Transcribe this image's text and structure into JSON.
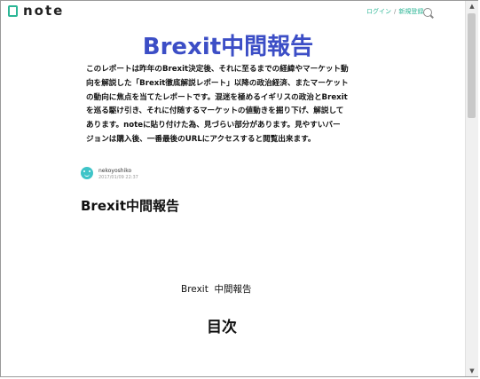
{
  "header": {
    "logo_text": "note",
    "login_label": "ログイン",
    "separator": "/",
    "signup_label": "新規登録"
  },
  "hero": {
    "title": "Brexit中間報告",
    "lines": [
      "このレポートは昨年のBrexit決定後、それに至るまでの経緯やマーケット動",
      "向を解説した「Brexit徹底解説レポート」以降の政治経済、またマーケット",
      "の動向に焦点を当てたレポートです。混迷を極めるイギリスの政治とBrexit",
      "を巡る駆け引き、それに付随するマーケットの値動きを掘り下げ、解説して",
      "あります。noteに貼り付けた為、見づらい部分があります。見やすいバー",
      "ジョンは購入後、一番最後のURLにアクセスすると閲覧出来ます。"
    ]
  },
  "author": {
    "name": "nekoyoshiko",
    "date": "2017/01/09 22:37"
  },
  "article": {
    "title": "Brexit中間報告",
    "subheading": "Brexit  中間報告",
    "toc_heading": "目次"
  },
  "scrollbar": {
    "up_arrow": "▲",
    "down_arrow": "▼"
  },
  "colors": {
    "accent": "#2cb696",
    "hero_title": "#3c4ec6"
  }
}
